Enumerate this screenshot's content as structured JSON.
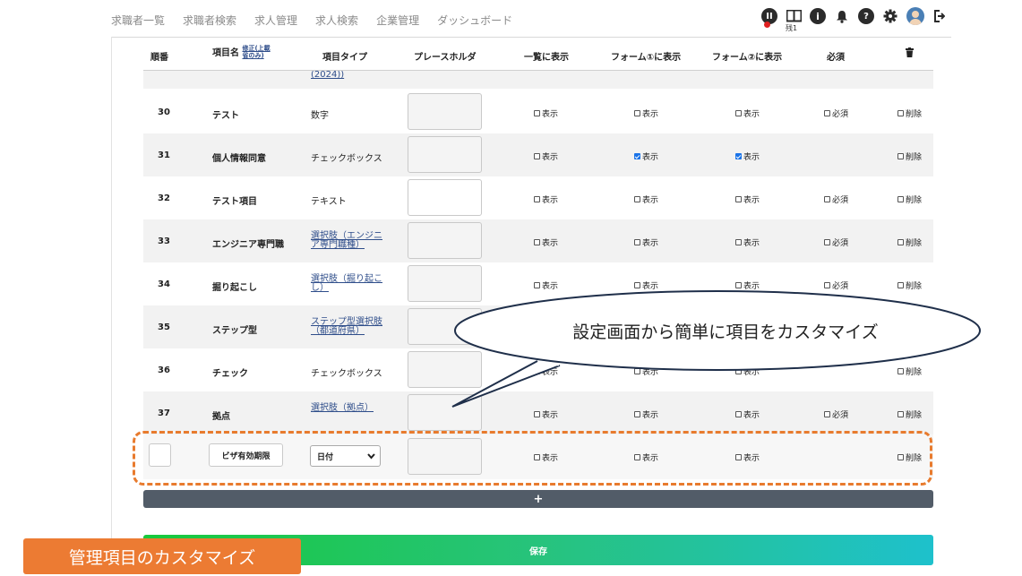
{
  "nav": {
    "items": [
      "求職者一覧",
      "求職者検索",
      "求人管理",
      "求人検索",
      "企業管理",
      "ダッシュボード"
    ]
  },
  "header_icons": {
    "book_label": "残1",
    "icons": [
      "notification-pause-icon",
      "book-icon",
      "info-icon",
      "bell-icon",
      "help-icon",
      "gear-icon",
      "avatar",
      "logout-icon"
    ]
  },
  "table": {
    "headers": {
      "order": "順番",
      "name": "項目名",
      "name_note": "修正(上載\n省のみ)",
      "type": "項目タイプ",
      "placeholder": "プレースホルダ",
      "list": "一覧に表示",
      "form1": "フォーム①に表示",
      "form2": "フォーム②に表示",
      "required": "必須",
      "delete": "trash-icon"
    },
    "partial_row_type": "(2024))",
    "rows": [
      {
        "num": "30",
        "name": "テスト",
        "type": "数字",
        "type_link": false,
        "ph_white": false,
        "list": false,
        "form1": false,
        "form2": false,
        "has_required": true,
        "required": false
      },
      {
        "num": "31",
        "name": "個人情報同意",
        "type": "チェックボックス",
        "type_link": false,
        "ph_white": false,
        "list": false,
        "form1": true,
        "form2": true,
        "has_required": false,
        "required": false
      },
      {
        "num": "32",
        "name": "テスト項目",
        "type": "テキスト",
        "type_link": false,
        "ph_white": true,
        "list": false,
        "form1": false,
        "form2": false,
        "has_required": true,
        "required": false
      },
      {
        "num": "33",
        "name": "エンジニア専門職",
        "type": "選択肢（エンジニア専門職種）",
        "type_link": true,
        "ph_white": false,
        "list": false,
        "form1": false,
        "form2": false,
        "has_required": true,
        "required": false
      },
      {
        "num": "34",
        "name": "掘り起こし",
        "type": "選択肢（掘り起こし）",
        "type_link": true,
        "ph_white": false,
        "list": false,
        "form1": false,
        "form2": false,
        "has_required": true,
        "required": false
      },
      {
        "num": "35",
        "name": "ステップ型",
        "type": "ステップ型選択肢（都道府県）",
        "type_link": true,
        "ph_white": false,
        "list": false,
        "form1": false,
        "form2": false,
        "has_required": false,
        "required": false
      },
      {
        "num": "36",
        "name": "チェック",
        "type": "チェックボックス",
        "type_link": false,
        "ph_white": false,
        "list": false,
        "form1": false,
        "form2": false,
        "has_required": false,
        "required": false
      },
      {
        "num": "37",
        "name": "拠点",
        "type": "選択肢（拠点）",
        "type_link": true,
        "ph_white": false,
        "list": false,
        "form1": false,
        "form2": false,
        "has_required": true,
        "required": false
      }
    ],
    "labels": {
      "show": "表示",
      "required": "必須",
      "delete": "削除"
    },
    "new_row": {
      "order_value": "",
      "name_value": "ビザ有効期限",
      "type_selected": "日付"
    }
  },
  "buttons": {
    "add": "+",
    "save": "保存"
  },
  "callout": {
    "text": "設定画面から簡単に項目をカスタマイズ"
  },
  "caption": {
    "text": "管理項目のカスタマイズ"
  },
  "colors": {
    "accent_orange": "#e87b2e",
    "link_blue": "#2e4d8a",
    "add_bar": "#525c68",
    "save_gradient_start": "#18c93c",
    "save_gradient_end": "#1ec1cc"
  }
}
